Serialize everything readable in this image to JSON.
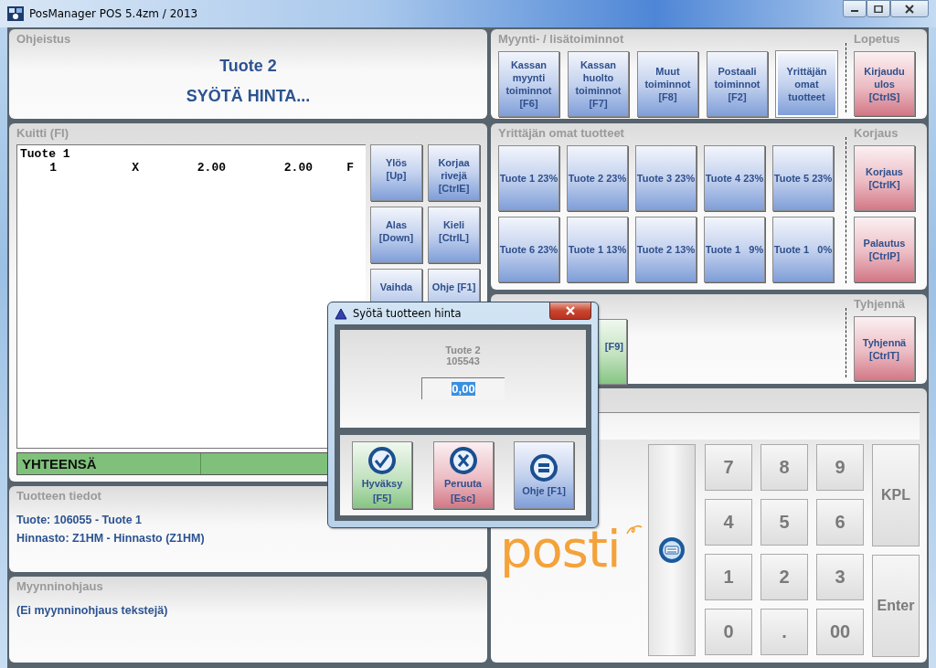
{
  "window": {
    "title": "PosManager POS 5.4zm / 2013"
  },
  "ohjeistus": {
    "title": "Ohjeistus",
    "product": "Tuote 2",
    "prompt": "SYÖTÄ HINTA..."
  },
  "kuitti": {
    "title": "Kuitti (FI)",
    "items": [
      {
        "name": "Tuote 1",
        "qty": "1",
        "mult": "X",
        "price": "2.00",
        "total": "2.00",
        "code": "F"
      }
    ],
    "buttons": [
      {
        "kind": "neutral",
        "lines": [
          "Ylös",
          "[Up]"
        ]
      },
      {
        "kind": "neutral",
        "lines": [
          "Korjaa",
          "rivejä",
          "[CtrlE]"
        ]
      },
      {
        "kind": "neutral",
        "lines": [
          "Alas",
          "[Down]"
        ]
      },
      {
        "kind": "neutral",
        "lines": [
          "Kieli",
          "[CtrlL]"
        ]
      },
      {
        "kind": "neutral",
        "lines": [
          "Vaihda"
        ]
      },
      {
        "kind": "neutral",
        "lines": [
          "Ohje [F1]"
        ]
      }
    ],
    "total_label": "YHTEENSÄ"
  },
  "tuotteen_tiedot": {
    "title": "Tuotteen tiedot",
    "lines": [
      "Tuote: 106055 - Tuote 1",
      "Hinnasto: Z1HM - Hinnasto (Z1HM)"
    ]
  },
  "myynninohjaus": {
    "title": "Myynninohjaus",
    "text": "(Ei myynninohjaus tekstejä)"
  },
  "myynti": {
    "title": "Myynti- / lisätoiminnot",
    "buttons": [
      {
        "kind": "neutral",
        "selected": false,
        "lines": [
          "Kassan",
          "myynti",
          "toiminnot",
          "[F6]"
        ]
      },
      {
        "kind": "neutral",
        "selected": false,
        "lines": [
          "Kassan",
          "huolto",
          "toiminnot",
          "[F7]"
        ]
      },
      {
        "kind": "neutral",
        "selected": false,
        "lines": [
          "Muut",
          "toiminnot",
          "[F8]"
        ]
      },
      {
        "kind": "neutral",
        "selected": false,
        "lines": [
          "Postaali",
          "toiminnot",
          "[F2]"
        ]
      },
      {
        "kind": "neutral",
        "selected": true,
        "lines": [
          "Yrittäjän",
          "omat",
          "tuotteet"
        ]
      }
    ],
    "side": {
      "title": "Lopetus",
      "buttons": [
        {
          "kind": "danger",
          "lines": [
            "Kirjaudu",
            "ulos",
            "[CtrlS]"
          ]
        }
      ]
    }
  },
  "omat": {
    "title": "Yrittäjän omat tuotteet",
    "buttons": [
      {
        "kind": "neutral",
        "lines": [
          "Tuote 1 23%"
        ]
      },
      {
        "kind": "neutral",
        "lines": [
          "Tuote 2 23%"
        ]
      },
      {
        "kind": "neutral",
        "lines": [
          "Tuote 3 23%"
        ]
      },
      {
        "kind": "neutral",
        "lines": [
          "Tuote 4 23%"
        ]
      },
      {
        "kind": "neutral",
        "lines": [
          "Tuote 5 23%"
        ]
      },
      {
        "kind": "neutral",
        "lines": [
          "Tuote 6 23%"
        ]
      },
      {
        "kind": "neutral",
        "lines": [
          "Tuote 1 13%"
        ]
      },
      {
        "kind": "neutral",
        "lines": [
          "Tuote 2 13%"
        ]
      },
      {
        "kind": "neutral",
        "lines": [
          "Tuote 1   9%"
        ]
      },
      {
        "kind": "neutral",
        "lines": [
          "Tuote 1   0%"
        ]
      }
    ],
    "side": {
      "title": "Korjaus",
      "buttons": [
        {
          "kind": "danger",
          "lines": [
            "Korjaus",
            "[CtrlK]"
          ]
        },
        {
          "kind": "danger",
          "lines": [
            "Palautus",
            "[CtrlP]"
          ]
        }
      ]
    }
  },
  "maksu": {
    "buttons": [
      {
        "kind": "confirm",
        "lines": [
          "[F9]"
        ]
      }
    ],
    "side": {
      "title": "Tyhjennä",
      "buttons": [
        {
          "kind": "danger",
          "lines": [
            "Tyhjennä",
            "[CtrlT]"
          ]
        }
      ]
    }
  },
  "keypad": {
    "logo": "posti",
    "digits": [
      "7",
      "8",
      "9",
      "4",
      "5",
      "6",
      "1",
      "2",
      "3",
      "0",
      ".",
      "00"
    ],
    "side": [
      "KPL",
      "Enter"
    ]
  },
  "dialog": {
    "title": "Syötä tuotteen hinta",
    "product": "Tuote 2",
    "code": "105543",
    "field": {
      "value": "0,00",
      "selected": true
    },
    "buttons": [
      {
        "kind": "confirm",
        "lines": [
          "Hyväksy",
          "[F5]"
        ]
      },
      {
        "kind": "danger",
        "lines": [
          "Peruuta",
          "[Esc]"
        ]
      },
      {
        "kind": "neutral",
        "lines": [
          "Ohje [F1]"
        ]
      }
    ]
  }
}
